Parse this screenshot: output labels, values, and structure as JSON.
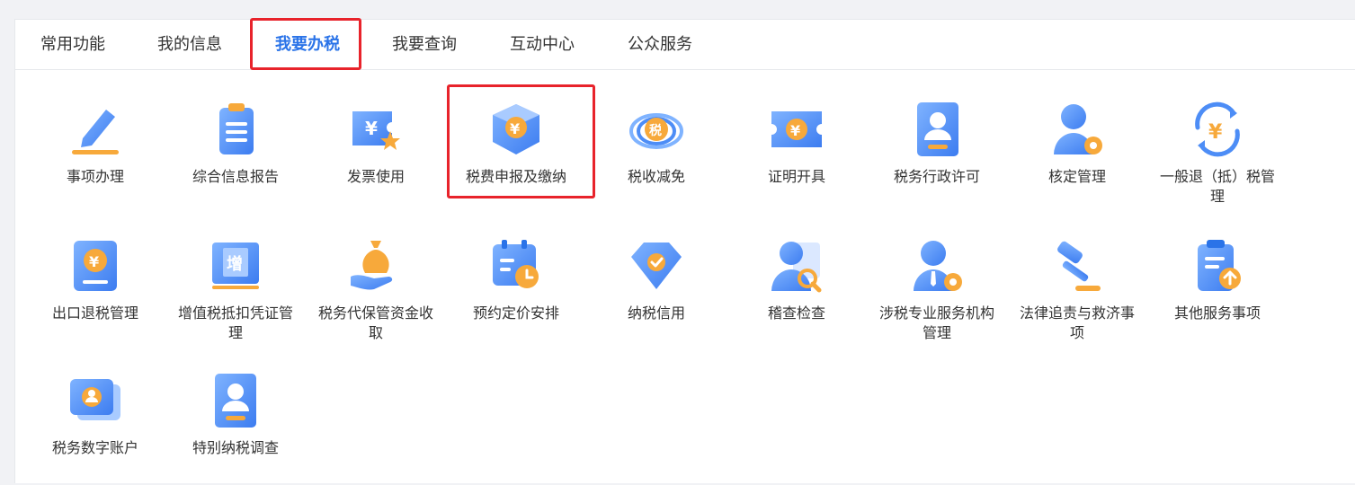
{
  "tabs": [
    {
      "label": "常用功能",
      "active": false
    },
    {
      "label": "我的信息",
      "active": false
    },
    {
      "label": "我要办税",
      "active": true
    },
    {
      "label": "我要查询",
      "active": false
    },
    {
      "label": "互动中心",
      "active": false
    },
    {
      "label": "公众服务",
      "active": false
    }
  ],
  "colors": {
    "active_tab": "#2a73e8",
    "highlight": "#e8232b",
    "icon_blue": "#4d8df6",
    "icon_orange": "#f7a93b"
  },
  "items": [
    {
      "label": "事项办理",
      "icon": "pencil-icon"
    },
    {
      "label": "综合信息报告",
      "icon": "clipboard-icon"
    },
    {
      "label": "发票使用",
      "icon": "invoice-star-icon"
    },
    {
      "label": "税费申报及缴纳",
      "icon": "yuan-box-icon"
    },
    {
      "label": "税收减免",
      "icon": "tax-reduction-icon"
    },
    {
      "label": "证明开具",
      "icon": "ticket-icon"
    },
    {
      "label": "税务行政许可",
      "icon": "id-card-icon"
    },
    {
      "label": "核定管理",
      "icon": "user-gear-icon"
    },
    {
      "label": "一般退（抵）税管理",
      "icon": "yuan-refresh-icon"
    },
    {
      "label": "出口退税管理",
      "icon": "yuan-book-icon"
    },
    {
      "label": "增值税抵扣凭证管理",
      "icon": "vat-voucher-icon"
    },
    {
      "label": "税务代保管资金收取",
      "icon": "money-bag-icon"
    },
    {
      "label": "预约定价安排",
      "icon": "calendar-clock-icon"
    },
    {
      "label": "纳税信用",
      "icon": "diamond-check-icon"
    },
    {
      "label": "稽查检查",
      "icon": "user-search-icon"
    },
    {
      "label": "涉税专业服务机构管理",
      "icon": "business-user-gear-icon"
    },
    {
      "label": "法律追责与救济事项",
      "icon": "gavel-icon"
    },
    {
      "label": "其他服务事项",
      "icon": "clipboard-upload-icon"
    },
    {
      "label": "税务数字账户",
      "icon": "digital-account-icon"
    },
    {
      "label": "特别纳税调查",
      "icon": "id-badge-icon"
    }
  ]
}
